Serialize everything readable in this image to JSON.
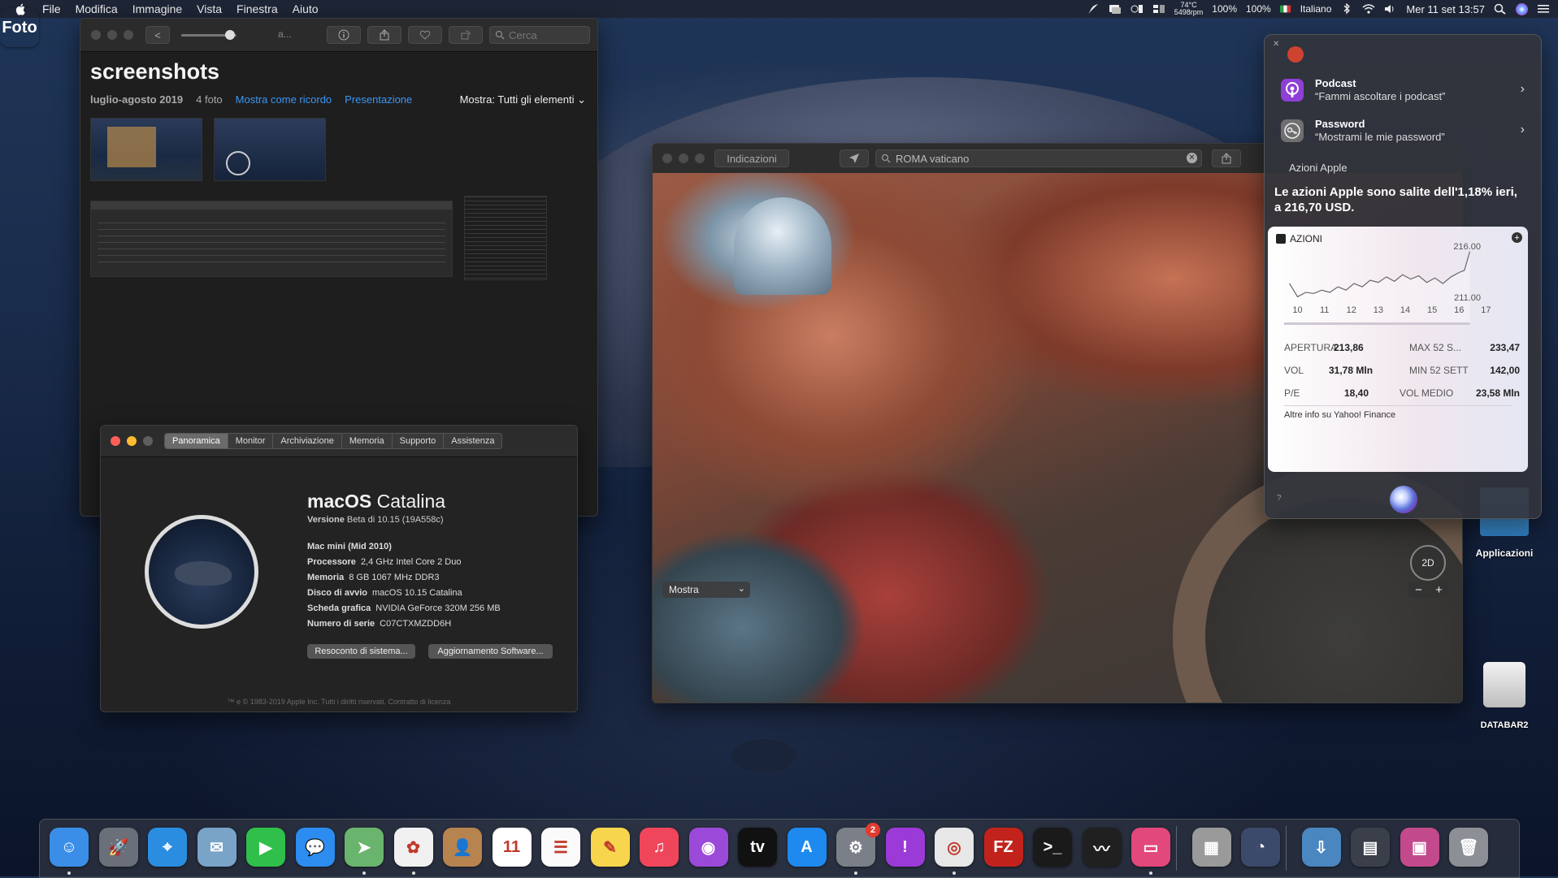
{
  "menubar": {
    "app_name": "Foto",
    "menus": [
      "File",
      "Modifica",
      "Immagine",
      "Vista",
      "Finestra",
      "Aiuto"
    ],
    "status_items": {
      "temp_top": "74°C",
      "fan_rpm": "5498rpm",
      "battery1": "100%",
      "battery2": "100%",
      "input_source": "Italiano",
      "datetime": "Mer 11 set  13:57"
    }
  },
  "photos": {
    "back_label": "<",
    "title_placeholder": "a...",
    "search_placeholder": "Cerca",
    "album_title": "screenshots",
    "date_range": "luglio-agosto 2019",
    "count": "4 foto",
    "memory_link": "Mostra come ricordo",
    "slideshow_link": "Presentazione",
    "show_filter": "Mostra: Tutti gli elementi"
  },
  "about": {
    "tabs": [
      "Panoramica",
      "Monitor",
      "Archiviazione",
      "Memoria",
      "Supporto",
      "Assistenza"
    ],
    "os_name_bold": "macOS",
    "os_name": "Catalina",
    "version_label": "Versione",
    "version_value": "Beta di 10.15 (19A558c)",
    "specs": [
      {
        "label": "Mac mini (Mid 2010)",
        "value": ""
      },
      {
        "label": "Processore",
        "value": "2,4 GHz Intel Core 2 Duo"
      },
      {
        "label": "Memoria",
        "value": "8 GB 1067 MHz DDR3"
      },
      {
        "label": "Disco di avvio",
        "value": "macOS 10.15 Catalina"
      },
      {
        "label": "Scheda grafica",
        "value": "NVIDIA GeForce 320M 256 MB"
      },
      {
        "label": "Numero di serie",
        "value": "C07CTXMZDD6H"
      }
    ],
    "report_button": "Resoconto di sistema...",
    "update_button": "Aggiornamento Software...",
    "footer": "™ e © 1983-2019 Apple Inc. Tutti i diritti riservati. Contratto di licenza"
  },
  "maps": {
    "directions_button": "Indicazioni",
    "search_value": "ROMA vaticano",
    "show_select": "Mostra",
    "view_mode": "2D",
    "zoom_out": "−",
    "zoom_in": "+"
  },
  "siri": {
    "suggestions": [
      {
        "title": "Podcast",
        "subtitle": "“Fammi ascoltare i podcast”",
        "icon": "podcast-icon",
        "color": "#8e3fd6"
      },
      {
        "title": "Password",
        "subtitle": "“Mostrami le mie password”",
        "icon": "key-icon",
        "color": "#6f6f6f"
      }
    ],
    "heading": "Azioni Apple",
    "answer": "Le azioni Apple sono salite dell'1,18% ieri, a 216,70 USD.",
    "stock_card": {
      "label": "AZIONI",
      "stats": [
        {
          "l1": "APERTURA",
          "v1": "213,86",
          "l2": "MAX 52 S...",
          "v2": "233,47"
        },
        {
          "l1": "VOL",
          "v1": "31,78 Mln",
          "l2": "MIN 52 SETT",
          "v2": "142,00"
        },
        {
          "l1": "P/E",
          "v1": "18,40",
          "l2": "VOL MEDIO",
          "v2": "23,58 Mln"
        }
      ],
      "more_link": "Altre info su Yahoo! Finance"
    },
    "help": "?"
  },
  "chart_data": {
    "type": "line",
    "title": "",
    "xlabel": "",
    "ylabel": "",
    "x_ticks": [
      "10",
      "11",
      "12",
      "13",
      "14",
      "15",
      "16",
      "17"
    ],
    "y_ticks": [
      "216.00",
      "211.00"
    ],
    "ylim": [
      211,
      216
    ],
    "x": [
      9.7,
      10.0,
      10.3,
      10.6,
      10.9,
      11.2,
      11.5,
      11.8,
      12.1,
      12.4,
      12.7,
      13.0,
      13.3,
      13.6,
      13.9,
      14.2,
      14.5,
      14.8,
      15.1,
      15.4,
      15.7,
      16.0,
      16.2,
      16.4
    ],
    "values": [
      213.2,
      212.0,
      212.4,
      212.3,
      212.6,
      212.4,
      212.9,
      212.6,
      213.2,
      212.9,
      213.5,
      213.3,
      213.8,
      213.4,
      214.0,
      213.6,
      213.9,
      213.3,
      213.7,
      213.2,
      213.8,
      214.2,
      214.4,
      216.1
    ],
    "grid": false,
    "legend": "none"
  },
  "desktop": {
    "icons": [
      {
        "label": "Applicazioni"
      },
      {
        "label": "DATABAR2"
      }
    ]
  },
  "dock": {
    "apps": [
      {
        "name": "finder-icon",
        "color": "#3b8ee8",
        "glyph": "☺",
        "running": true
      },
      {
        "name": "launchpad-icon",
        "color": "#6a6f7a",
        "glyph": "🚀",
        "running": false
      },
      {
        "name": "safari-icon",
        "color": "#2b8de0",
        "glyph": "⌖",
        "running": false
      },
      {
        "name": "mail-stamp-icon",
        "color": "#7aa3c8",
        "glyph": "✉",
        "running": false
      },
      {
        "name": "facetime-icon",
        "color": "#2fbf4a",
        "glyph": "▶",
        "running": false
      },
      {
        "name": "messages-icon",
        "color": "#2c8cf0",
        "glyph": "💬",
        "running": false
      },
      {
        "name": "maps-icon",
        "color": "#6ab56d",
        "glyph": "➤",
        "running": true
      },
      {
        "name": "photos-icon",
        "color": "#f0f0f0",
        "glyph": "✿",
        "running": true
      },
      {
        "name": "contacts-icon",
        "color": "#b7834f",
        "glyph": "👤",
        "running": false
      },
      {
        "name": "calendar-icon",
        "color": "#ffffff",
        "glyph": "11",
        "running": false
      },
      {
        "name": "reminders-icon",
        "color": "#fafafa",
        "glyph": "☰",
        "running": false
      },
      {
        "name": "notes-icon",
        "color": "#f7d54c",
        "glyph": "✎",
        "running": false
      },
      {
        "name": "music-icon",
        "color": "#f0465b",
        "glyph": "♫",
        "running": false
      },
      {
        "name": "podcasts-icon",
        "color": "#9b49d8",
        "glyph": "◉",
        "running": false
      },
      {
        "name": "apple-tv-icon",
        "color": "#111111",
        "glyph": "tv",
        "running": false
      },
      {
        "name": "app-store-icon",
        "color": "#1e8af0",
        "glyph": "A",
        "running": false
      },
      {
        "name": "system-preferences-icon",
        "color": "#7b7f88",
        "glyph": "⚙",
        "running": true,
        "badge": "2"
      },
      {
        "name": "feedback-icon",
        "color": "#9c3ad8",
        "glyph": "!",
        "running": false
      },
      {
        "name": "chrome-icon",
        "color": "#e7e7e7",
        "glyph": "◎",
        "running": true
      },
      {
        "name": "filezilla-icon",
        "color": "#c1231c",
        "glyph": "FZ",
        "running": false
      },
      {
        "name": "terminal-icon",
        "color": "#1a1a1a",
        "glyph": ">_",
        "running": false
      },
      {
        "name": "activity-monitor-icon",
        "color": "#202020",
        "glyph": "〰",
        "running": false
      },
      {
        "name": "cleanmymac-icon",
        "color": "#e2487b",
        "glyph": "▭",
        "running": true
      },
      {
        "name": "calculator-icon",
        "color": "#9a9a9a",
        "glyph": "▦",
        "running": false
      },
      {
        "name": "time-machine-icon",
        "color": "#3b4a6a",
        "glyph": "◔",
        "running": false
      },
      {
        "name": "downloads-folder-icon",
        "color": "#4a86c0",
        "glyph": "⇩",
        "running": false
      },
      {
        "name": "screenshots-stack-icon",
        "color": "#3a3f4a",
        "glyph": "▤",
        "running": false
      },
      {
        "name": "screen-sharing-icon",
        "color": "#c24a8c",
        "glyph": "▣",
        "running": false
      },
      {
        "name": "trash-icon",
        "color": "#8c8f95",
        "glyph": "🗑",
        "running": false
      }
    ]
  }
}
